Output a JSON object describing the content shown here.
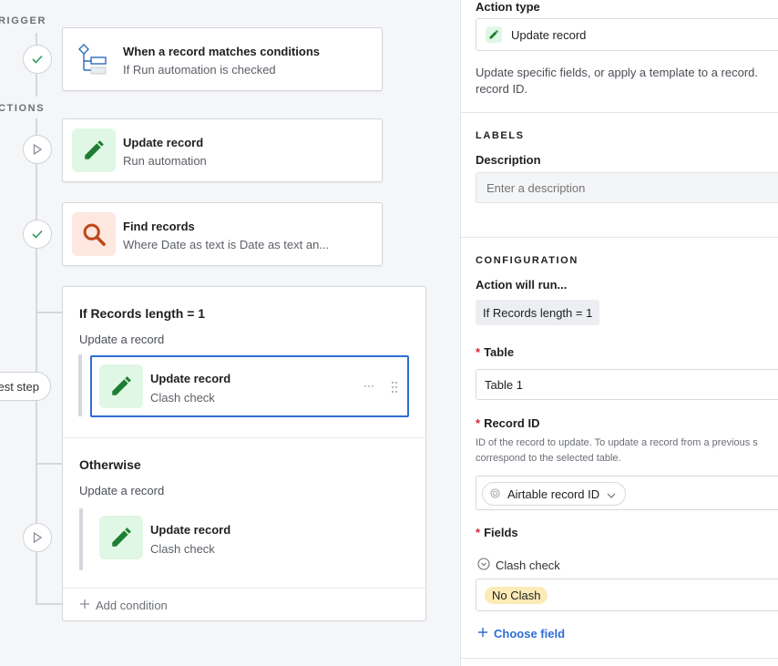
{
  "flow": {
    "trigger_label": "RIGGER",
    "actions_label": "CTIONS",
    "test_step_label": "est step",
    "trigger_card": {
      "title": "When a record matches conditions",
      "subtitle": "If Run automation is checked"
    },
    "action_cards": [
      {
        "title": "Update record",
        "subtitle": "Run automation"
      },
      {
        "title": "Find records",
        "subtitle": "Where Date as text is Date as text an..."
      }
    ],
    "conditional": {
      "branch1": {
        "heading": "If Records length = 1",
        "subheading": "Update a record",
        "card": {
          "title": "Update record",
          "subtitle": "Clash check"
        }
      },
      "branch2": {
        "heading": "Otherwise",
        "subheading": "Update a record",
        "card": {
          "title": "Update record",
          "subtitle": "Clash check"
        }
      },
      "add_condition": "Add condition",
      "more_menu": "···"
    }
  },
  "panel": {
    "action_type_label": "Action type",
    "action_type_value": "Update record",
    "action_type_desc_1": "Update specific fields, or apply a template to a record.",
    "action_type_desc_2": "record ID.",
    "labels_section": "LABELS",
    "description_label": "Description",
    "description_placeholder": "Enter a description",
    "configuration_section": "CONFIGURATION",
    "action_will_run": "Action will run...",
    "condition_chip": "If Records length = 1",
    "table_label": "Table",
    "table_value": "Table 1",
    "record_id_label": "Record ID",
    "record_id_help_1": "ID of the record to update. To update a record from a previous s",
    "record_id_help_2": "correspond to the selected table.",
    "record_id_token": "Airtable record ID",
    "fields_label": "Fields",
    "field_name": "Clash check",
    "field_value": "No Clash",
    "choose_field": "Choose field",
    "required_mark": "*"
  },
  "colors": {
    "accent_blue": "#2d6dd6",
    "green_icon": "#1e7d32",
    "orange_icon": "#c0461b",
    "chip_yellow": "#fcebb6"
  }
}
